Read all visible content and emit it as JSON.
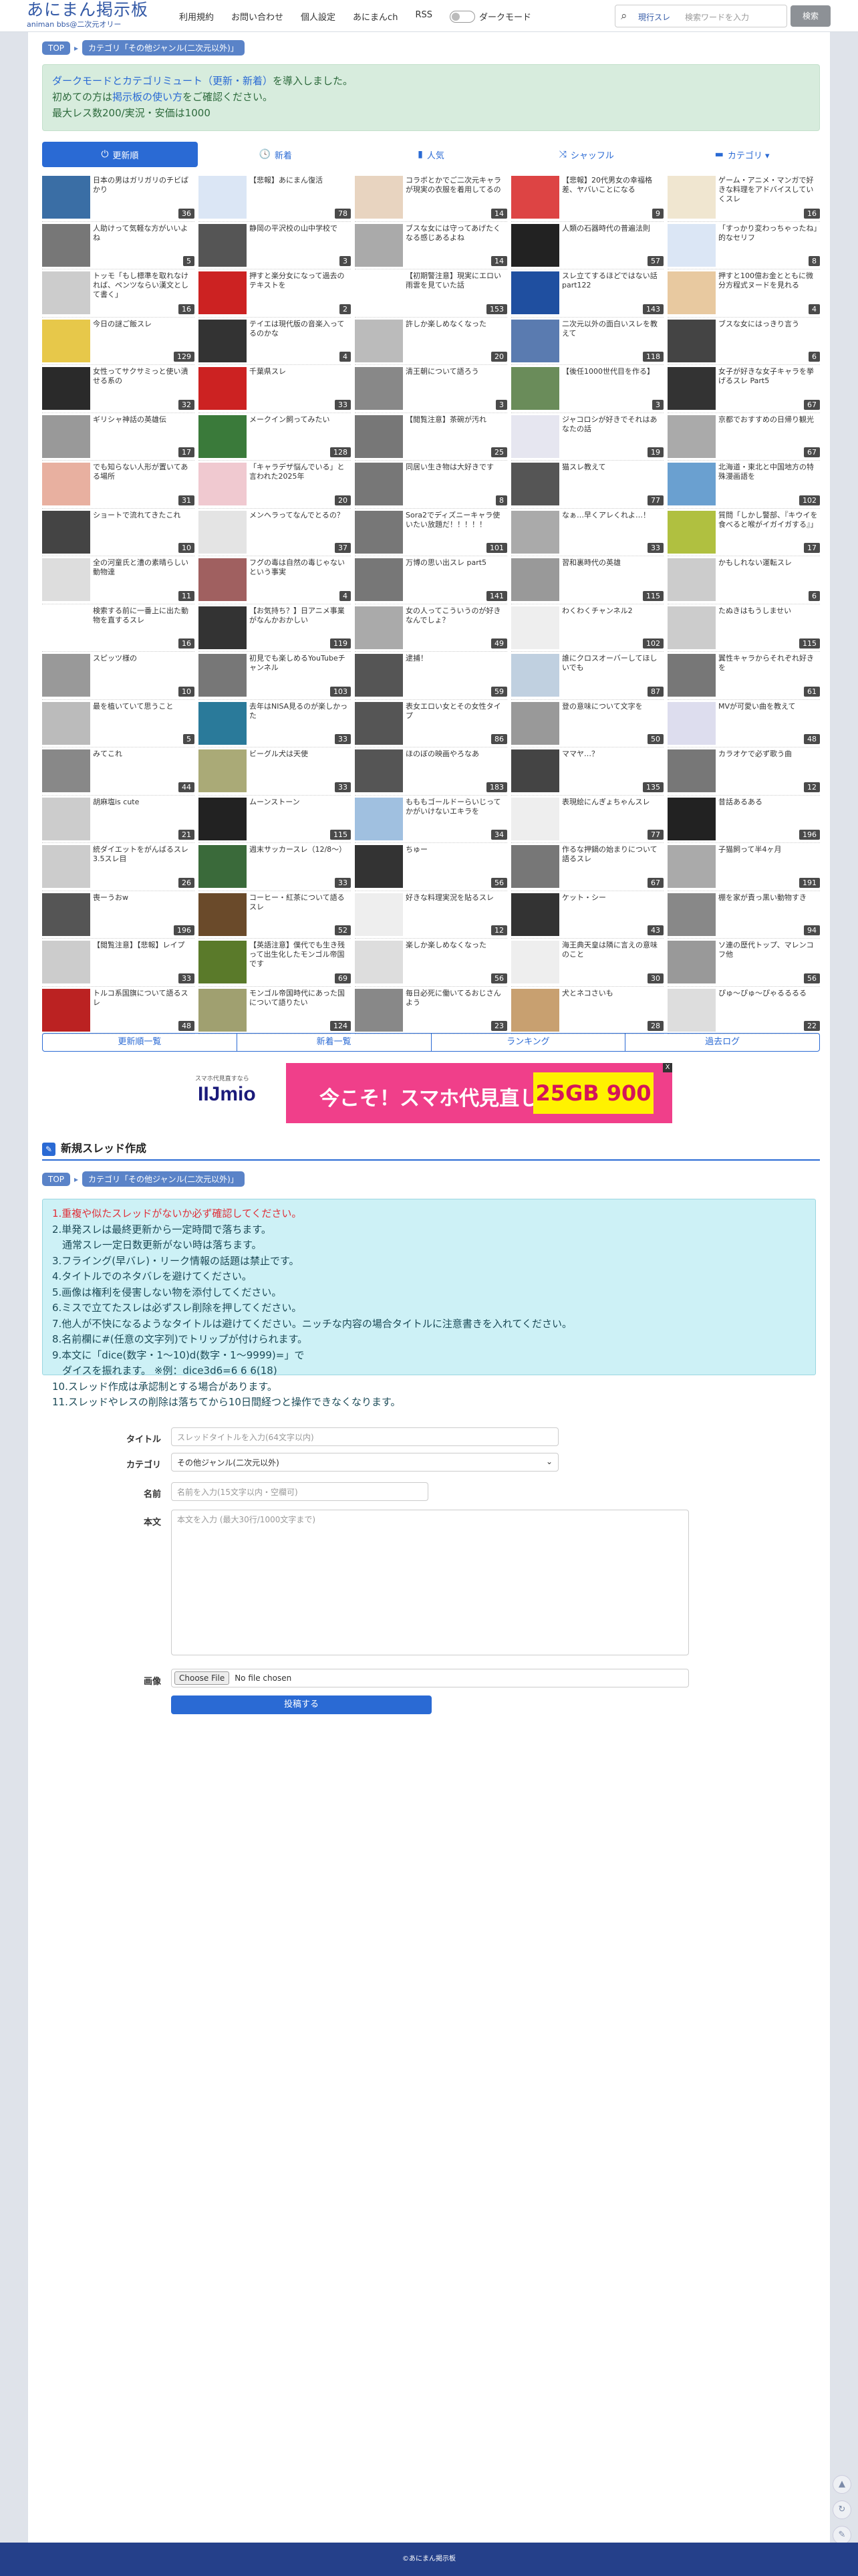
{
  "header": {
    "logo_main": "あにまん掲示板",
    "logo_sub": "animan bbs@二次元オリー",
    "nav": [
      "利用規約",
      "お問い合わせ",
      "個人設定",
      "あにまんch",
      "RSS"
    ],
    "dark_mode_label": "ダークモード",
    "search_scope": "現行スレ",
    "search_placeholder": "検索ワードを入力",
    "search_button": "検索"
  },
  "breadcrumb": {
    "top": "TOP",
    "category": "カテゴリ「その他ジャンル(二次元以外)」"
  },
  "notice": {
    "line1_link": "ダークモードとカテゴリミュート（更新・新着）",
    "line1_rest": "を導入しました。",
    "line2_pre": "初めての方は",
    "line2_link": "掲示板の使い方",
    "line2_post": "をご確認ください。",
    "line3": "最大レス数200/実況・安価は1000"
  },
  "tabs": [
    {
      "icon": "⏻",
      "label": "更新順"
    },
    {
      "icon": "🕓",
      "label": "新着"
    },
    {
      "icon": "▮",
      "label": "人気"
    },
    {
      "icon": "⤨",
      "label": "シャッフル"
    },
    {
      "icon": "▬",
      "label": "カテゴリ ▾"
    }
  ],
  "threads": [
    {
      "t": "日本の男はガリガリのチビばかり",
      "c": "36",
      "col": "#3a6ea5"
    },
    {
      "t": "【悲報】あにまん復活",
      "c": "78",
      "col": "#dbe6f5"
    },
    {
      "t": "コラボとかでご二次元キャラが現実の衣服を着用してるの",
      "c": "14",
      "col": "#e8d4c0"
    },
    {
      "t": "【悲報】20代男女の幸福格差、ヤバいことになる",
      "c": "9",
      "col": "#d44"
    },
    {
      "t": "ゲーム・アニメ・マンガで好きな料理をアドバイスしていくスレ",
      "c": "16",
      "col": "#f0e6d0"
    },
    {
      "t": "人助けって気軽な方がいいよね",
      "c": "5",
      "col": "#777"
    },
    {
      "t": "静岡の平沢校の山中学校で",
      "c": "3",
      "col": "#555"
    },
    {
      "t": "ブスな女には守ってあげたくなる感じあるよね",
      "c": "14",
      "col": "#aaa"
    },
    {
      "t": "人類の石器時代の普遍法則",
      "c": "57",
      "col": "#222"
    },
    {
      "t": "「すっかり変わっちゃったね」的なセリフ",
      "c": "8",
      "col": "#dbe6f5"
    },
    {
      "t": "トッモ「もし標準を取れなければ、ペンツならい漢文として書く」",
      "c": "16",
      "col": "#ccc"
    },
    {
      "t": "押すと楽分女になって過去のテキストを",
      "c": "2",
      "col": "#c22"
    },
    {
      "t": "【初期警注意】現実にエロい雨雲を見ていた話",
      "c": "153",
      "col": "#fff"
    },
    {
      "t": "スレ立てするほどではない話part122",
      "c": "143",
      "col": "#1f4fa0"
    },
    {
      "t": "押すと100億お金とともに微分方程式ヌードを見れる",
      "c": "4",
      "col": "#e8c9a0"
    },
    {
      "t": "今日の謎ご飯スレ",
      "c": "129",
      "col": "#e7c84a"
    },
    {
      "t": "テイエは現代版の音楽入ってるのかな",
      "c": "4",
      "col": "#333"
    },
    {
      "t": "許しか楽しめなくなった",
      "c": "20",
      "col": "#bbb"
    },
    {
      "t": "二次元以外の面白いスレを教えて",
      "c": "118",
      "col": "#5a7bb0"
    },
    {
      "t": "ブスな女にはっきり言う",
      "c": "6",
      "col": "#444"
    },
    {
      "t": "女性ってサクサミっと使い潰せる系の",
      "c": "32",
      "col": "#2a2a2a"
    },
    {
      "t": "千葉県スレ",
      "c": "33",
      "col": "#c22"
    },
    {
      "t": "清王朝について語ろう",
      "c": "3",
      "col": "#888"
    },
    {
      "t": "【後任1000世代目を作る】",
      "c": "3",
      "col": "#6a8c5a"
    },
    {
      "t": "女子が好きな女子キャラを挙げるスレ Part5",
      "c": "67",
      "col": "#333"
    },
    {
      "t": "ギリシャ神話の英雄伝",
      "c": "17",
      "col": "#999"
    },
    {
      "t": "メークイン飼ってみたい",
      "c": "128",
      "col": "#3a7a3a"
    },
    {
      "t": "【閲覧注意】茶碗が汚れ",
      "c": "25",
      "col": "#777"
    },
    {
      "t": "ジャコロシが好きでそれはあなたの話",
      "c": "19",
      "col": "#e6e6f0"
    },
    {
      "t": "京都でおすすめの日帰り観光",
      "c": "67",
      "col": "#aaa"
    },
    {
      "t": "でも知らない人形が置いてある場所",
      "c": "31",
      "col": "#e8b0a0"
    },
    {
      "t": "「キャラデザ悩んでいる」と言われた2025年",
      "c": "20",
      "col": "#f0c9d0"
    },
    {
      "t": "同居い生き物は大好きです",
      "c": "8",
      "col": "#777"
    },
    {
      "t": "猫スレ教えて",
      "c": "77",
      "col": "#555"
    },
    {
      "t": "北海道・東北と中国地方の特殊漫画語を",
      "c": "102",
      "col": "#6aa0d0"
    },
    {
      "t": "ショートで流れてきたこれ",
      "c": "10",
      "col": "#444"
    },
    {
      "t": "メンヘラってなんでとるの？",
      "c": "37",
      "col": "#e4e4e4"
    },
    {
      "t": "Sora2でディズニーキャラ使いたい放題だ！！！！！",
      "c": "101",
      "col": "#777"
    },
    {
      "t": "なぁ…早くアレくれよ…！",
      "c": "33",
      "col": "#aaa"
    },
    {
      "t": "質問「しかし警部、『キウイを食べると喉がイガイガする』」",
      "c": "17",
      "col": "#b0c040"
    },
    {
      "t": "全の河童氏と漕の素晴らしい動物達",
      "c": "11",
      "col": "#ddd"
    },
    {
      "t": "フグの毒は自然の毒じゃないという事実",
      "c": "4",
      "col": "#a06060"
    },
    {
      "t": "万博の思い出スレ part5",
      "c": "141",
      "col": "#777"
    },
    {
      "t": "習和裏時代の英雄",
      "c": "115",
      "col": "#999"
    },
    {
      "t": "かもしれない運転スレ",
      "c": "6",
      "col": "#ccc"
    },
    {
      "t": "検索する前に一番上に出た動物を直するスレ",
      "c": "16",
      "col": "#fff"
    },
    {
      "t": "【お気持ち？】日アニメ事業がなんかおかしい",
      "c": "119",
      "col": "#333"
    },
    {
      "t": "女の人ってこういうのが好きなんでしょ？",
      "c": "49",
      "col": "#aaa"
    },
    {
      "t": "わくわくチャンネル2",
      "c": "102",
      "col": "#eee"
    },
    {
      "t": "たぬきはもうしませい",
      "c": "115",
      "col": "#ccc"
    },
    {
      "t": "スピッツ様の",
      "c": "10",
      "col": "#999"
    },
    {
      "t": "初見でも楽しめるYouTubeチャンネル",
      "c": "103",
      "col": "#777"
    },
    {
      "t": "逮捕！",
      "c": "59",
      "col": "#555"
    },
    {
      "t": "誰にクロスオーバーしてほしいでも",
      "c": "87",
      "col": "#c0d0e0"
    },
    {
      "t": "翼性キャラからそれぞれ好きを",
      "c": "61",
      "col": "#777"
    },
    {
      "t": "最を植いていて思うこと",
      "c": "5",
      "col": "#bbb"
    },
    {
      "t": "去年はNISA見るのが楽しかった",
      "c": "33",
      "col": "#2a7a9a"
    },
    {
      "t": "表女エロい女とその女性タイプ",
      "c": "86",
      "col": "#555"
    },
    {
      "t": "登の意味について文字を",
      "c": "50",
      "col": "#999"
    },
    {
      "t": "MVが可愛い曲を教えて",
      "c": "48",
      "col": "#dde"
    },
    {
      "t": "みてこれ",
      "c": "44",
      "col": "#888"
    },
    {
      "t": "ビーグル犬は天使",
      "c": "33",
      "col": "#aa7"
    },
    {
      "t": "ほのぼの映画やろなあ",
      "c": "183",
      "col": "#555"
    },
    {
      "t": "ママヤ…？",
      "c": "135",
      "col": "#444"
    },
    {
      "t": "カラオケで必ず歌う曲",
      "c": "12",
      "col": "#777"
    },
    {
      "t": "胡麻塩is cute",
      "c": "21",
      "col": "#ccc"
    },
    {
      "t": "ムーンストーン",
      "c": "115",
      "col": "#222"
    },
    {
      "t": "もももゴールドーらいじってかがいけないエキラを",
      "c": "34",
      "col": "#a0c0e0"
    },
    {
      "t": "表現絵にんぎょちゃんスレ",
      "c": "77",
      "col": "#eee"
    },
    {
      "t": "昔話あるある",
      "c": "196",
      "col": "#222"
    },
    {
      "t": "統ダイエットをがんばるスレ 3.5スレ目",
      "c": "26",
      "col": "#ccc"
    },
    {
      "t": "週末サッカースレ（12/8〜）",
      "c": "33",
      "col": "#3a6a3a"
    },
    {
      "t": "ちゅー",
      "c": "56",
      "col": "#333"
    },
    {
      "t": "作るな押鍋の始まりについて語るスレ",
      "c": "67",
      "col": "#777"
    },
    {
      "t": "子猫飼って半4ヶ月",
      "c": "191",
      "col": "#aaa"
    },
    {
      "t": "喪ーうおw",
      "c": "196",
      "col": "#555"
    },
    {
      "t": "コーヒー・紅茶について語るスレ",
      "c": "52",
      "col": "#6a4a2a"
    },
    {
      "t": "好きな料理実況を貼るスレ",
      "c": "12",
      "col": "#eee"
    },
    {
      "t": "ケット・シー",
      "c": "43",
      "col": "#333"
    },
    {
      "t": "棚を家が責っ黒い動物すき",
      "c": "94",
      "col": "#888"
    },
    {
      "t": "【閲覧注意】【悲報】レイプ",
      "c": "33",
      "col": "#ccc"
    },
    {
      "t": "【英語注意】僕代でも生き残って出生化したモンゴル帝国です",
      "c": "69",
      "col": "#5a7a2a"
    },
    {
      "t": "楽しか楽しめなくなった",
      "c": "56",
      "col": "#ddd"
    },
    {
      "t": "海王典天皇は隣に言えの意味のこと",
      "c": "30",
      "col": "#eee"
    },
    {
      "t": "ソ連の歴代トップ、マレンコフ他",
      "c": "56",
      "col": "#999"
    },
    {
      "t": "トルコ系国旗について語るスレ",
      "c": "48",
      "col": "#b22"
    },
    {
      "t": "モンゴル帝国時代にあった国について語りたい",
      "c": "124",
      "col": "#a0a070"
    },
    {
      "t": "毎日必死に働いてるおじさんよう",
      "c": "23",
      "col": "#888"
    },
    {
      "t": "犬とネコさいも",
      "c": "28",
      "col": "#c8a070"
    },
    {
      "t": "ぴゅ〜ぴゅ〜ぴゃるるるる",
      "c": "22",
      "col": "#ddd"
    }
  ],
  "bottom_links": [
    "更新順一覧",
    "新着一覧",
    "ランキング",
    "過去ログ"
  ],
  "ad": {
    "small": "スマホ代見直すなら",
    "brand": "IIJmio",
    "headline": "今こそ！スマホ代見直しませんか？",
    "price": "25GB 900円",
    "close": "X"
  },
  "form": {
    "heading": "新規スレッド作成",
    "rules": [
      "1.重複や似たスレッドがないか必ず確認してください。",
      "2.単発スレは最終更新から一定時間で落ちます。",
      "　通常スレ一定日数更新がない時は落ちます。",
      "3.フライング(早バレ)・リーク情報の話題は禁止です。",
      "4.タイトルでのネタバレを避けてください。",
      "5.画像は権利を侵害しない物を添付してください。",
      "6.ミスで立てたスレは必ずスレ削除を押してください。",
      "7.他人が不快になるようなタイトルは避けてください。ニッチな内容の場合タイトルに注意書きを入れてください。",
      "8.名前欄に#(任意の文字列)でトリップが付けられます。",
      "9.本文に「dice(数字・1〜10)d(数字・1〜9999)=」で",
      "　ダイスを振れます。 ※例：dice3d6=6 6 6(18)",
      "10.スレッド作成は承認制とする場合があります。",
      "11.スレッドやレスの削除は落ちてから10日間経つと操作できなくなります。"
    ],
    "title_label": "タイトル",
    "title_placeholder": "スレッドタイトルを入力(64文字以内)",
    "category_label": "カテゴリ",
    "category_value": "その他ジャンル(二次元以外)",
    "name_label": "名前",
    "name_placeholder": "名前を入力(15文字以内・空欄可)",
    "body_label": "本文",
    "body_placeholder": "本文を入力 (最大30行/1000文字まで)",
    "image_label": "画像",
    "file_button": "Choose File",
    "file_status": "No file chosen",
    "submit": "投稿する"
  },
  "footer": "©あにまん掲示板"
}
